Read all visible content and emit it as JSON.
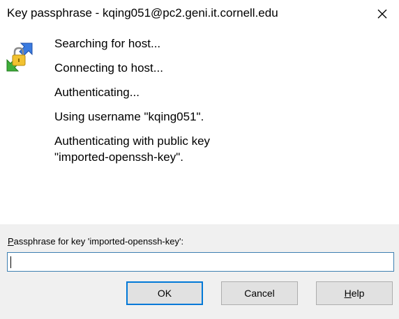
{
  "window": {
    "title": "Key passphrase - kqing051@pc2.geni.it.cornell.edu",
    "close_glyph": "✕"
  },
  "messages": [
    "Searching for host...",
    "Connecting to host...",
    "Authenticating...",
    "Using username \"kqing051\".",
    "Authenticating with public key\n\"imported-openssh-key\"."
  ],
  "prompt": {
    "label_mnemonic": "P",
    "label_rest": "assphrase for key 'imported-openssh-key':",
    "value": ""
  },
  "buttons": {
    "ok": "OK",
    "cancel": "Cancel",
    "help_mnemonic": "H",
    "help_rest": "elp"
  },
  "colors": {
    "panel_bg": "#f0f0f0",
    "focus_border": "#0078d7",
    "input_border": "#3c7fb1"
  },
  "icons": [
    "putty-key-icon",
    "close-icon"
  ]
}
